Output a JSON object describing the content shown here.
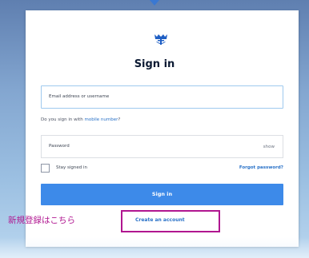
{
  "header": {
    "title": "Sign in",
    "logo_icon": "crown-anchor-icon"
  },
  "form": {
    "email_placeholder": "Email address or username",
    "hint_text": "Do you sign in with ",
    "hint_link": "mobile number",
    "hint_suffix": "?",
    "password_placeholder": "Password",
    "show_label": "show",
    "stay_signed_in_label": "Stay signed in",
    "stay_signed_in_checked": false,
    "forgot_password_label": "Forgot password?",
    "signin_button_label": "Sign in",
    "create_account_label": "Create an account"
  },
  "annotation": {
    "text": "新規登録はこちら",
    "color": "#b01690"
  },
  "colors": {
    "primary_button": "#3d8ae9",
    "link": "#2a72c8",
    "title": "#0c1a33",
    "brand_icon": "#1f5fc4"
  }
}
